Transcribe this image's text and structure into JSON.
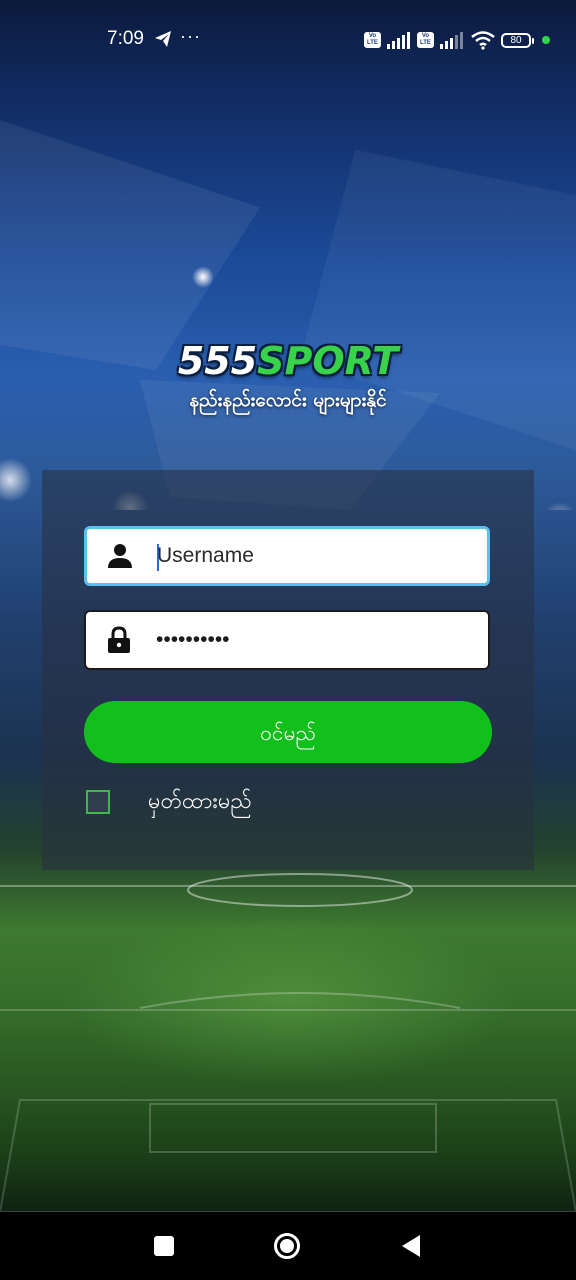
{
  "status_bar": {
    "time": "7:09",
    "more": "···",
    "volte_badge": "Vo LTE",
    "battery_level": "80",
    "icons": [
      "telegram-send-icon",
      "signal-icon",
      "wifi-icon",
      "battery-icon",
      "charging-dot-icon"
    ]
  },
  "brand": {
    "logo_number": "555",
    "logo_word": "SPORT",
    "tagline": "နည်းနည်းလောင်း များများနိုင်",
    "accent_color": "#38d34b"
  },
  "login_form": {
    "username_placeholder": "Username",
    "username_value": "",
    "password_value": "••••••••••",
    "login_button_label": "ဝင်မည်",
    "remember_label": "မှတ်ထားမည်",
    "button_color": "#12c01c"
  }
}
